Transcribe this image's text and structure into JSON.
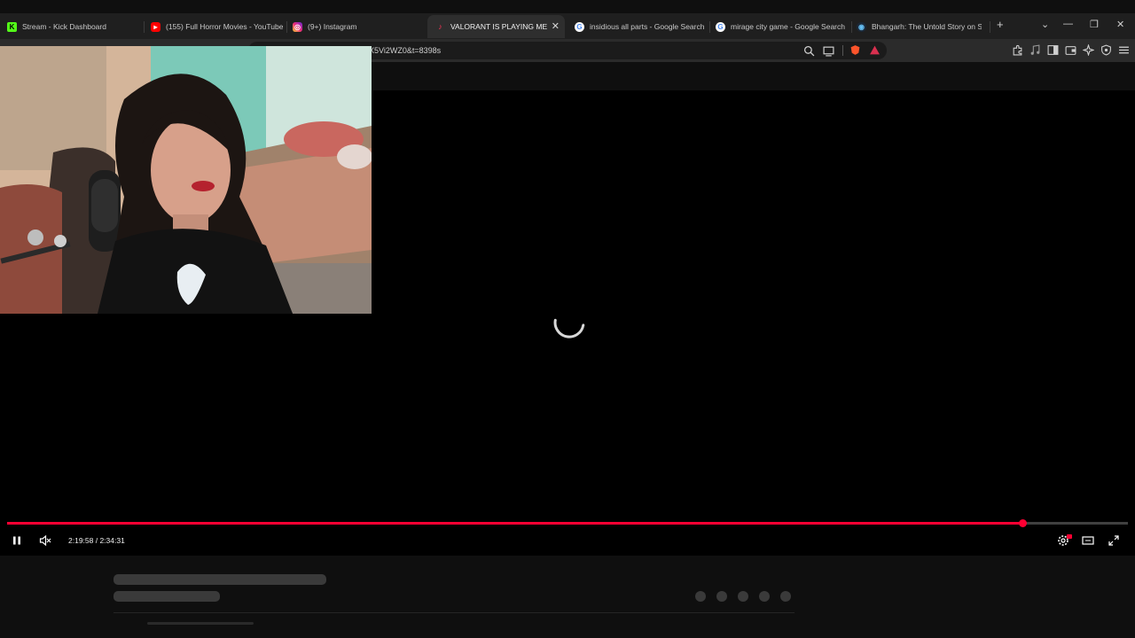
{
  "browser": {
    "tabs": [
      {
        "label": "Stream - Kick Dashboard",
        "icon": "kick-icon",
        "active": false
      },
      {
        "label": "(155) Full Horror Movies - YouTube",
        "icon": "youtube-icon",
        "active": false
      },
      {
        "label": "(9+) Instagram",
        "icon": "instagram-icon",
        "active": false
      },
      {
        "label": "VALORANT IS PLAYING ME GN",
        "icon": "youtube-audio-icon",
        "active": true
      },
      {
        "label": "insidious all parts - Google Search",
        "icon": "google-icon",
        "active": false
      },
      {
        "label": "mirage city game - Google Search",
        "icon": "google-icon",
        "active": false
      },
      {
        "label": "Bhangarh: The Untold Story on Stea",
        "icon": "steam-icon",
        "active": false
      }
    ],
    "new_tab_symbol": "+",
    "url": "X5Vi2WZ0&t=8398s"
  },
  "player": {
    "current_time": "2:19:58",
    "duration": "2:34:31",
    "time_display": "2:19:58 / 2:34:31",
    "progress": 0.906,
    "state": "loading"
  },
  "colors": {
    "accent": "#ff0033",
    "background": "#0f0f0f",
    "player_bg": "#000000"
  }
}
